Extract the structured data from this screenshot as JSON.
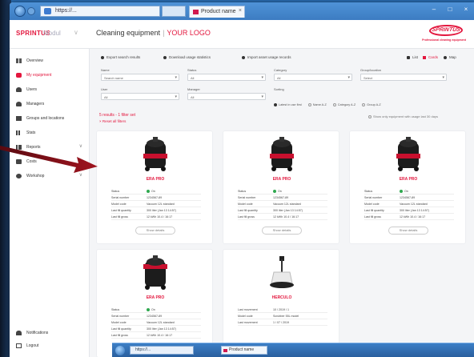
{
  "browser": {
    "address": "https://...",
    "tab_label": "Product name",
    "tab_close": "×",
    "controls": [
      "–",
      "□",
      "×"
    ]
  },
  "header": {
    "brand": "SPRINTUS",
    "brand_sub": "Modul",
    "chevron": "∨",
    "title_main": "Cleaning equipment",
    "title_sep": "|",
    "title_logo": "YOUR LOGO",
    "logo_text": "SPRINTUS",
    "logo_sub": "Professional cleaning equipment"
  },
  "sidebar": {
    "items": [
      {
        "label": "Overview",
        "icon": "grid-icon",
        "active": false
      },
      {
        "label": "My equipment",
        "icon": "vacuum-icon",
        "active": true
      },
      {
        "label": "Users",
        "icon": "users-icon",
        "active": false
      },
      {
        "label": "Managers",
        "icon": "manager-icon",
        "active": false
      },
      {
        "label": "Groups and locations",
        "icon": "location-icon",
        "active": false
      },
      {
        "label": "Stats",
        "icon": "chart-icon",
        "active": false
      },
      {
        "label": "Reports",
        "icon": "report-icon",
        "active": false
      },
      {
        "label": "Costs",
        "icon": "costs-icon",
        "active": false
      },
      {
        "label": "Workshop",
        "icon": "settings-icon",
        "active": false
      }
    ],
    "bottom": [
      {
        "label": "Notifications",
        "icon": "bell-icon"
      },
      {
        "label": "Logout",
        "icon": "logout-icon"
      }
    ]
  },
  "toolbar": {
    "actions": [
      "Export search results",
      "Download usage statistics",
      "Import asset usage records"
    ],
    "views": [
      "List",
      "Cards",
      "Map"
    ]
  },
  "filters": {
    "row1": [
      {
        "label": "Name",
        "value": "Search name"
      },
      {
        "label": "Status",
        "value": "All"
      },
      {
        "label": "Category",
        "value": "All"
      },
      {
        "label": "Group/location",
        "value": "Select"
      }
    ],
    "row2": [
      {
        "label": "User",
        "value": "All"
      },
      {
        "label": "Manager",
        "value": "All"
      }
    ],
    "sorting_label": "Sorting",
    "sorting_options": [
      {
        "label": "Latest in use first",
        "on": true
      },
      {
        "label": "Name A-Z",
        "on": false
      },
      {
        "label": "Category A-Z",
        "on": false
      },
      {
        "label": "Group A-Z",
        "on": false
      }
    ]
  },
  "results": {
    "count": "5 results - 1 filter set",
    "filter_link": "× Reset all filters",
    "note": "Show only equipment with usage last 30 days"
  },
  "cards": [
    {
      "name": "ERA PRO",
      "image": "vacuum-icon",
      "rows": [
        [
          "Status",
          "On"
        ],
        [
          "Serial number",
          "1234567-89"
        ],
        [
          "Model code",
          "Vacuum 12L standard"
        ],
        [
          "Last fill quantity",
          "300 liter (Jan 13 14:57)"
        ],
        [
          "Last fill gross",
          "12 kWh 10.4 / 16:17"
        ]
      ],
      "button": "Show details"
    },
    {
      "name": "ERA PRO",
      "image": "vacuum-icon",
      "rows": [
        [
          "Status",
          "On"
        ],
        [
          "Serial number",
          "1234567-89"
        ],
        [
          "Model code",
          "Vacuum 12L standard"
        ],
        [
          "Last fill quantity",
          "300 liter (Jan 13 14:57)"
        ],
        [
          "Last fill gross",
          "12 kWh 10.4 / 16:17"
        ]
      ],
      "button": "Show details"
    },
    {
      "name": "ERA PRO",
      "image": "vacuum-icon",
      "rows": [
        [
          "Status",
          "On"
        ],
        [
          "Serial number",
          "1234567-89"
        ],
        [
          "Model code",
          "Vacuum 12L standard"
        ],
        [
          "Last fill quantity",
          "300 liter (Jan 13 14:57)"
        ],
        [
          "Last fill gross",
          "12 kWh 10.4 / 16:17"
        ]
      ],
      "button": "Show details"
    },
    {
      "name": "ERA PRO",
      "image": "vacuum-icon",
      "rows": [
        [
          "Status",
          "On"
        ],
        [
          "Serial number",
          "1234567-89"
        ],
        [
          "Model code",
          "Vacuum 12L standard"
        ],
        [
          "Last fill quantity",
          "300 liter (Jan 13 14:57)"
        ],
        [
          "Last fill gross",
          "12 kWh 10.4 / 16:17"
        ]
      ],
      "button": "Show details"
    },
    {
      "name": "HERCULO",
      "image": "scrubber-icon",
      "rows": [
        [
          "Last movement",
          "10 / 2019 / 1"
        ],
        [
          "Model code",
          "Scrubber 55L model"
        ],
        [
          "Last movement",
          "1 / 07 / 2019"
        ]
      ],
      "button": ""
    }
  ],
  "colors": {
    "accent": "#e3173e",
    "status_green": "#2fa84f",
    "arrow": "#a0141f"
  }
}
